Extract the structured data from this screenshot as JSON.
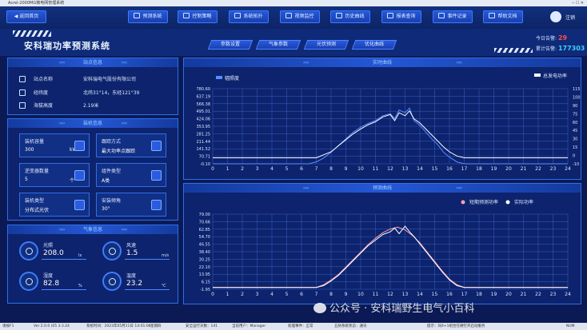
{
  "window": {
    "title": "Acrel-2000MG微电网管理系统"
  },
  "nav": {
    "back": "返回首页",
    "items": [
      "预测系统",
      "控制策略",
      "系统拓扑",
      "视频监控",
      "历史曲线",
      "报表查询",
      "事件记录",
      "帮助文档"
    ],
    "logout": "注销"
  },
  "header": {
    "title": "安科瑞功率预测系统",
    "tabs": [
      "参数设置",
      "气象参数",
      "光伏预测",
      "优化曲线"
    ],
    "alarm_today_label": "今日告警:",
    "alarm_today": "29",
    "alarm_total_label": "累计告警:",
    "alarm_total": "177303"
  },
  "station": {
    "title": "站点信息",
    "rows": [
      {
        "label": "站点名称",
        "value": "安科瑞电气股份有限公司",
        "icon": "home-icon"
      },
      {
        "label": "经纬度",
        "value": "北纬31°14，东经121°39",
        "icon": "compass-icon"
      },
      {
        "label": "海拔高度",
        "value": "2.19米",
        "icon": "building-icon"
      }
    ]
  },
  "install": {
    "title": "装机信息",
    "cards": [
      {
        "label": "装机容量",
        "value": "300",
        "unit": "kW"
      },
      {
        "label": "跟踪方式",
        "value": "最大功率点跟踪"
      },
      {
        "label": "逆变器数量",
        "value": "5",
        "unit": "个"
      },
      {
        "label": "组件类型",
        "value": "A类"
      },
      {
        "label": "装机类型",
        "value": "分布式光伏"
      },
      {
        "label": "安装倾角",
        "value": "30°"
      }
    ]
  },
  "weather": {
    "title": "气象信息",
    "items": [
      {
        "label": "光照",
        "value": "208.0",
        "unit": "lx"
      },
      {
        "label": "风速",
        "value": "1.5",
        "unit": "m/s"
      },
      {
        "label": "湿度",
        "value": "82.8",
        "unit": "%"
      },
      {
        "label": "温度",
        "value": "23.2",
        "unit": "℃"
      }
    ]
  },
  "chart_data": [
    {
      "type": "line",
      "title": "实时曲线",
      "x": [
        0,
        1,
        2,
        3,
        4,
        5,
        6,
        7,
        8,
        9,
        10,
        11,
        12,
        13,
        14,
        15,
        16,
        17,
        18,
        19,
        20,
        21,
        22,
        23,
        24
      ],
      "y_ticks_left": [
        "780.60",
        "637.19",
        "566.38",
        "495.01",
        "424.06",
        "353.95",
        "281.25",
        "211.44",
        "141.52",
        "70.71",
        "-0.10"
      ],
      "y_ticks_right": [
        "115",
        "100",
        "90",
        "75",
        "60",
        "45",
        "30",
        "15",
        "0",
        "-10"
      ],
      "series": [
        {
          "name": "辐照度",
          "axis": "left",
          "color": "#5a8cff",
          "x": [
            0,
            6.5,
            7,
            7.5,
            8,
            8.5,
            9,
            9.5,
            10,
            10.5,
            11,
            11.5,
            12,
            12.3,
            12.6,
            13,
            13.3,
            13.6,
            14,
            14.4,
            14.8,
            15.2,
            15.6,
            16,
            16.5,
            17,
            24
          ],
          "y": [
            0,
            0,
            20,
            60,
            120,
            190,
            260,
            330,
            380,
            420,
            450,
            500,
            520,
            470,
            560,
            530,
            580,
            450,
            400,
            330,
            260,
            200,
            120,
            70,
            20,
            0,
            0
          ]
        },
        {
          "name": "总发电功率",
          "axis": "right",
          "color": "#ffffff",
          "x": [
            0,
            7,
            7.5,
            8,
            8.5,
            9,
            9.5,
            10,
            10.5,
            11,
            11.5,
            12,
            12.3,
            12.6,
            13,
            13.3,
            13.6,
            14,
            14.4,
            14.8,
            15.2,
            15.6,
            16,
            16.5,
            17,
            24
          ],
          "y": [
            0,
            0,
            5,
            10,
            20,
            30,
            40,
            48,
            55,
            60,
            68,
            72,
            62,
            75,
            70,
            78,
            65,
            58,
            48,
            38,
            28,
            18,
            10,
            3,
            0,
            0
          ]
        }
      ]
    },
    {
      "type": "line",
      "title": "预测曲线",
      "x": [
        0,
        1,
        2,
        3,
        4,
        5,
        6,
        7,
        8,
        9,
        10,
        11,
        12,
        13,
        14,
        15,
        16,
        17,
        18,
        19,
        20,
        21,
        22,
        23,
        24
      ],
      "y_ticks": [
        "79.00",
        "70.66",
        "62.85",
        "54.70",
        "46.55",
        "38.40",
        "30.25",
        "22.10",
        "13.95",
        "6.15",
        "-1.95"
      ],
      "series": [
        {
          "name": "短期预测功率",
          "color": "#ff9fb0",
          "x": [
            0,
            7,
            7.5,
            8,
            8.5,
            9,
            9.5,
            10,
            10.5,
            11,
            11.5,
            12,
            12.5,
            13,
            13.5,
            14,
            14.5,
            15,
            15.5,
            16,
            16.5,
            17,
            24
          ],
          "y": [
            0,
            0,
            3,
            8,
            14,
            22,
            30,
            38,
            46,
            53,
            59,
            63,
            65,
            62,
            56,
            48,
            38,
            28,
            18,
            9,
            3,
            0,
            0
          ]
        },
        {
          "name": "实际功率",
          "color": "#ffffff",
          "x": [
            0,
            7,
            7.5,
            8,
            8.5,
            9,
            9.5,
            10,
            10.5,
            11,
            11.5,
            12,
            12.3,
            12.6,
            13,
            13.3,
            13.6,
            14,
            14.5,
            15,
            15.5,
            16,
            16.5,
            17,
            24
          ],
          "y": [
            0,
            0,
            2,
            7,
            13,
            21,
            29,
            37,
            45,
            51,
            57,
            60,
            64,
            58,
            66,
            60,
            55,
            47,
            37,
            27,
            17,
            8,
            2,
            0,
            0
          ]
        }
      ]
    }
  ],
  "status": {
    "items": [
      "请按F1",
      "Ver 2.0.0 (05 3.3.24",
      "系统时间：2023年05月11日 14:01:06",
      "星期四",
      "安全运行天数：141",
      "当前用户：Manager",
      "处理事件：正常",
      "五防系统状态：通讯",
      "提示：同4+1组合在硬打开启动服务",
      "NUM"
    ]
  },
  "watermark": "公众号 · 安科瑞野生电气小百科"
}
